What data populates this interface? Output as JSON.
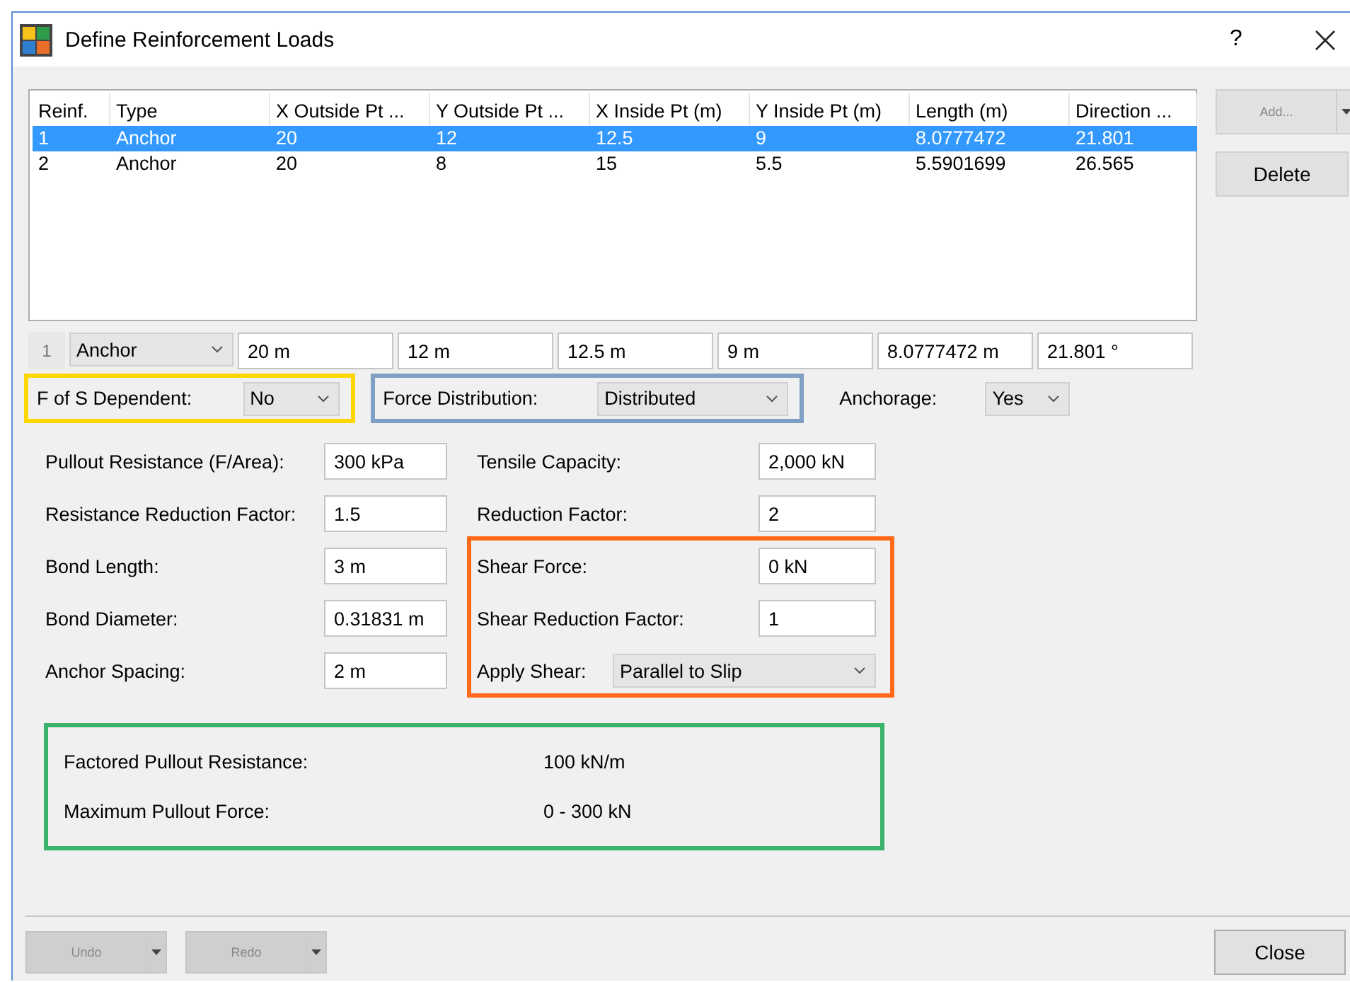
{
  "window": {
    "title": "Define Reinforcement Loads",
    "help": "?"
  },
  "table": {
    "columns": [
      "Reinf.",
      "Type",
      "X Outside Pt ...",
      "Y Outside Pt ...",
      "X Inside Pt (m)",
      "Y Inside Pt (m)",
      "Length (m)",
      "Direction ..."
    ],
    "rows": [
      {
        "selected": true,
        "cells": [
          "1",
          "Anchor",
          "20",
          "12",
          "12.5",
          "9",
          "8.0777472",
          "21.801"
        ]
      },
      {
        "selected": false,
        "cells": [
          "2",
          "Anchor",
          "20",
          "8",
          "15",
          "5.5",
          "5.5901699",
          "26.565"
        ]
      }
    ]
  },
  "side_buttons": [
    {
      "label": "Add...",
      "kind": "split",
      "disabled": true
    },
    {
      "label": "Delete",
      "kind": "plain",
      "disabled": false
    }
  ],
  "editor_row": {
    "index": "1",
    "type": "Anchor",
    "fields": [
      "20 m",
      "12 m",
      "12.5 m",
      "9 m",
      "8.0777472 m",
      "21.801 °"
    ]
  },
  "options": [
    {
      "label": "F of S Dependent:",
      "value": "No",
      "color": "#ffd700"
    },
    {
      "label": "Force Distribution:",
      "value": "Distributed",
      "color": "#7f9fc4"
    },
    {
      "label": "Anchorage:",
      "value": "Yes"
    }
  ],
  "left_fields": [
    {
      "label": "Pullout Resistance (F/Area):",
      "value": "300 kPa"
    },
    {
      "label": "Resistance Reduction Factor:",
      "value": "1.5"
    },
    {
      "label": "Bond Length:",
      "value": "3 m"
    },
    {
      "label": "Bond Diameter:",
      "value": "0.31831 m"
    },
    {
      "label": "Anchor Spacing:",
      "value": "2 m"
    }
  ],
  "right_fields": [
    {
      "label": "Tensile Capacity:",
      "value": "2,000 kN"
    },
    {
      "label": "Reduction Factor:",
      "value": "2"
    }
  ],
  "shear": {
    "color": "#ff6a1a",
    "fields": [
      {
        "label": "Shear Force:",
        "value": "0 kN"
      },
      {
        "label": "Shear Reduction Factor:",
        "value": "1"
      }
    ],
    "apply_shear": {
      "label": "Apply Shear:",
      "value": "Parallel to Slip"
    }
  },
  "results": {
    "color": "#3cb36b",
    "rows": [
      {
        "label": "Factored Pullout Resistance:",
        "value": "100 kN/m"
      },
      {
        "label": "Maximum Pullout Force:",
        "value": "0 - 300 kN"
      }
    ]
  },
  "footer": {
    "history_buttons": [
      {
        "label": "Undo",
        "disabled": true
      },
      {
        "label": "Redo",
        "disabled": true
      }
    ],
    "close": "Close"
  }
}
